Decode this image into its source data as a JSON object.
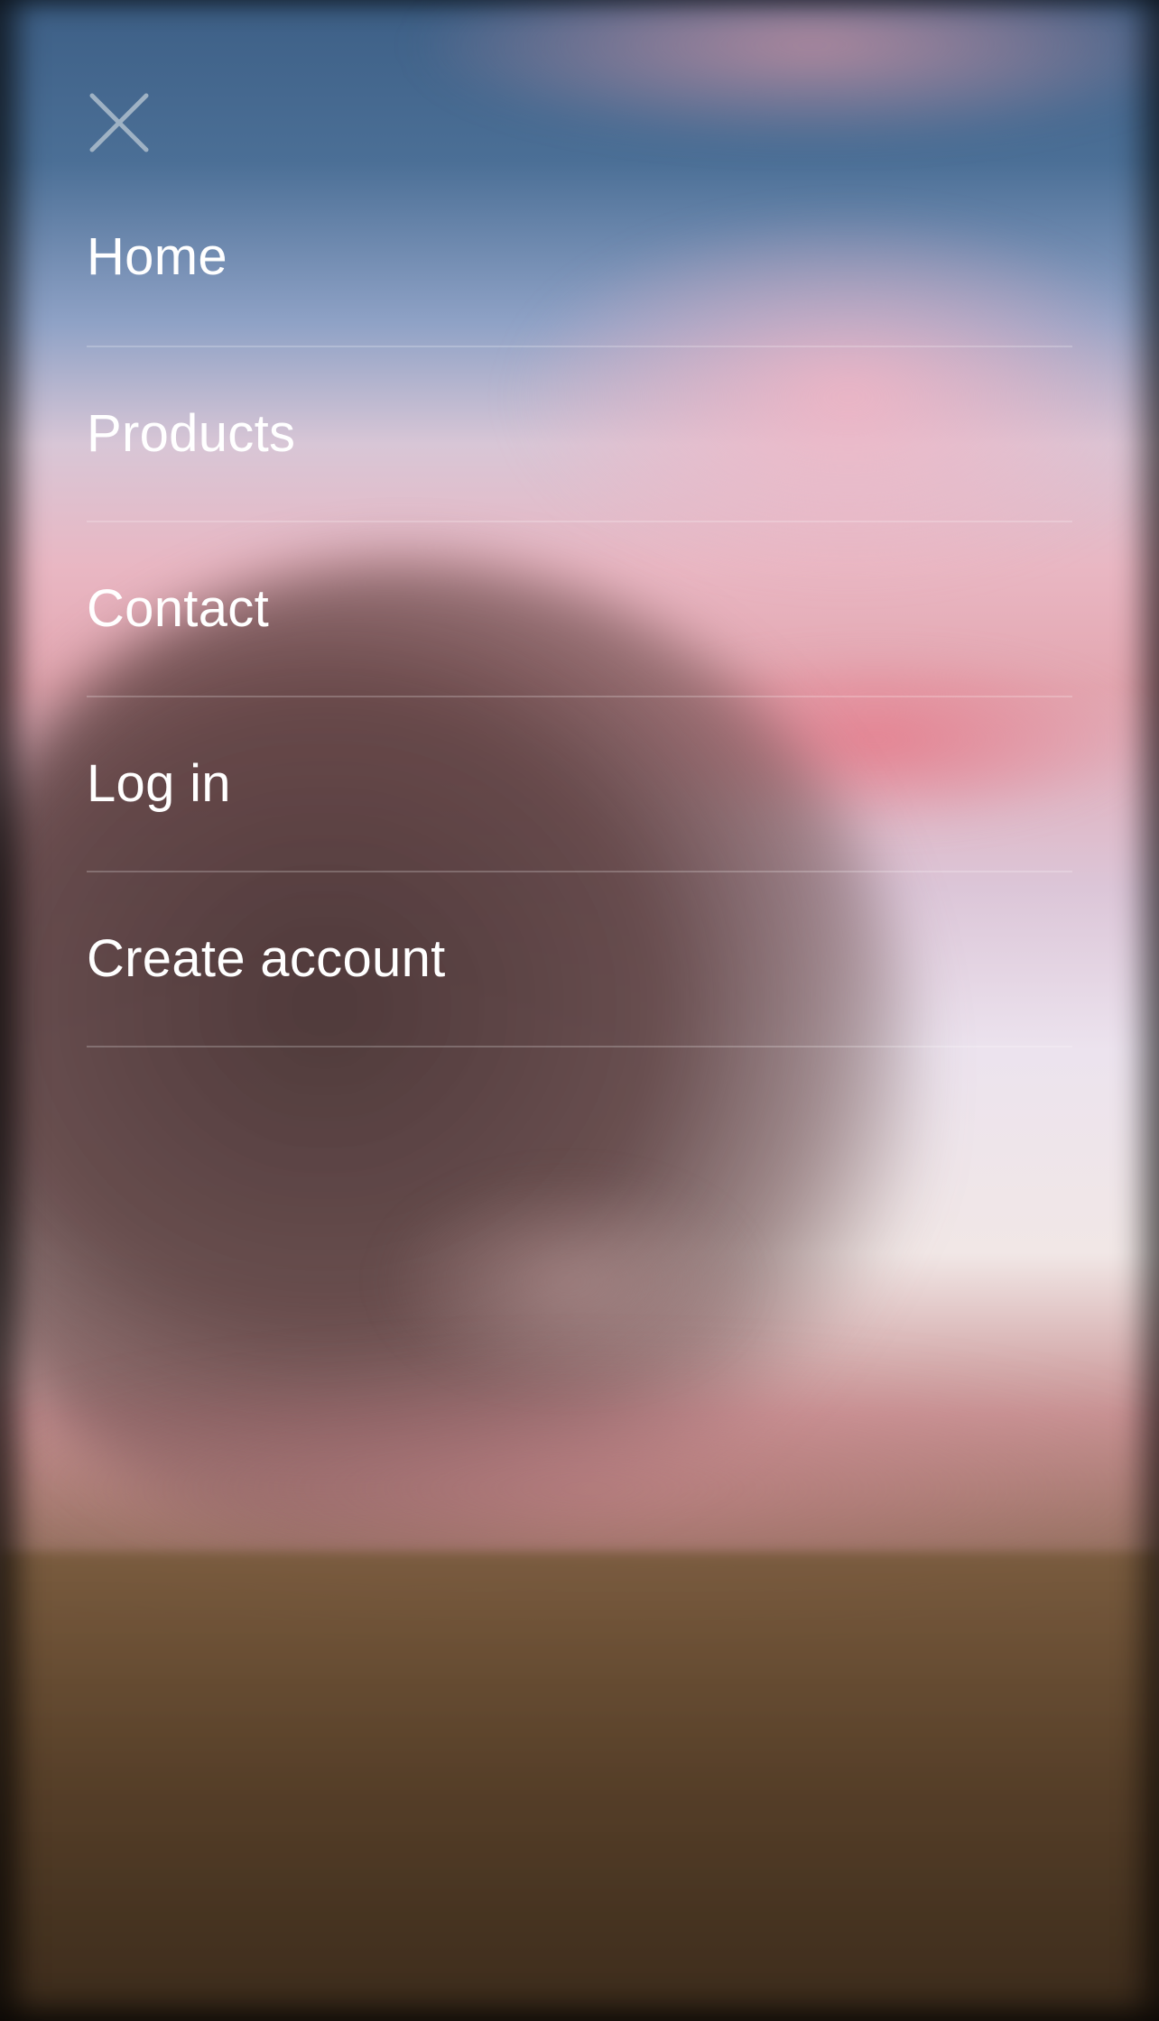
{
  "menu": {
    "close_icon": "close-icon",
    "items": [
      {
        "label": "Home"
      },
      {
        "label": "Products"
      },
      {
        "label": "Contact"
      },
      {
        "label": "Log in"
      },
      {
        "label": "Create account"
      }
    ]
  },
  "colors": {
    "menu_text": "#ffffff",
    "close_icon": "#9fb2c4",
    "divider": "rgba(255,255,255,0.22)"
  }
}
